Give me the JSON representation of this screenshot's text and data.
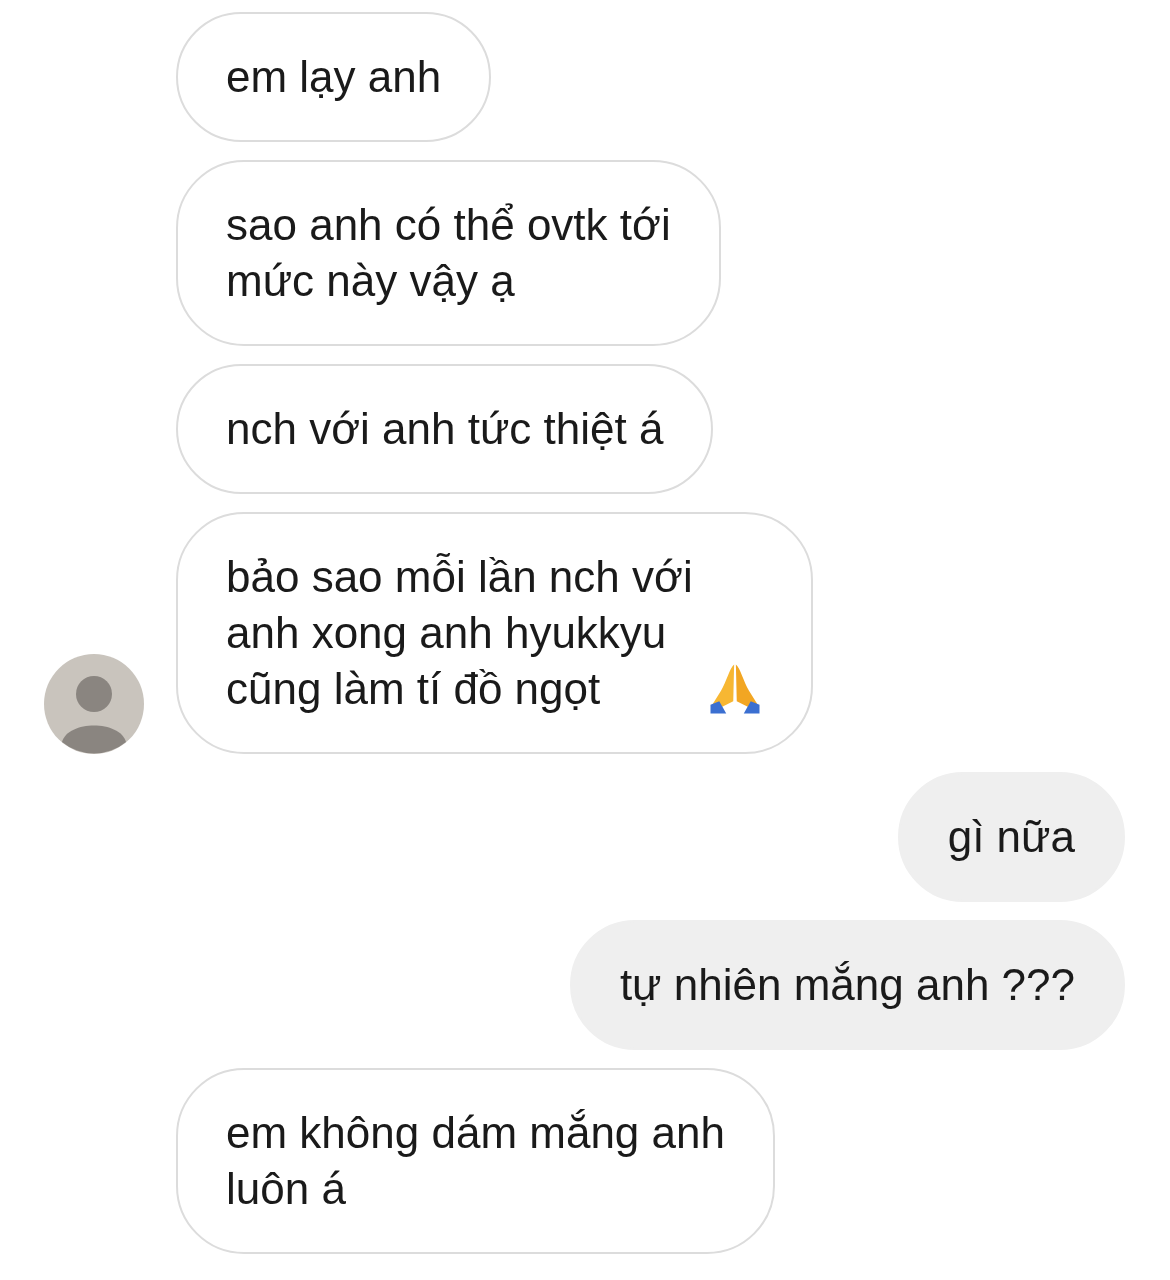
{
  "messages": [
    {
      "kind": "received",
      "lines": [
        "em lạy anh"
      ],
      "show_avatar": false,
      "emoji_after": false
    },
    {
      "kind": "received",
      "lines": [
        "sao anh có thể ovtk tới",
        "mức này vậy ạ"
      ],
      "show_avatar": false,
      "emoji_after": false
    },
    {
      "kind": "received",
      "lines": [
        "nch với anh tức thiệt á"
      ],
      "show_avatar": false,
      "emoji_after": false
    },
    {
      "kind": "received",
      "lines": [
        "bảo sao mỗi lần nch với",
        "anh xong anh hyukkyu",
        "cũng làm tí đồ ngọt"
      ],
      "show_avatar": true,
      "emoji_after": true
    },
    {
      "kind": "sent",
      "lines": [
        "gì nữa"
      ],
      "show_avatar": false,
      "emoji_after": false
    },
    {
      "kind": "sent",
      "lines": [
        "tự nhiên mắng anh ???"
      ],
      "show_avatar": false,
      "emoji_after": false
    },
    {
      "kind": "received",
      "lines": [
        "em không dám mắng anh",
        "luôn á"
      ],
      "show_avatar": false,
      "emoji_after": false
    }
  ]
}
